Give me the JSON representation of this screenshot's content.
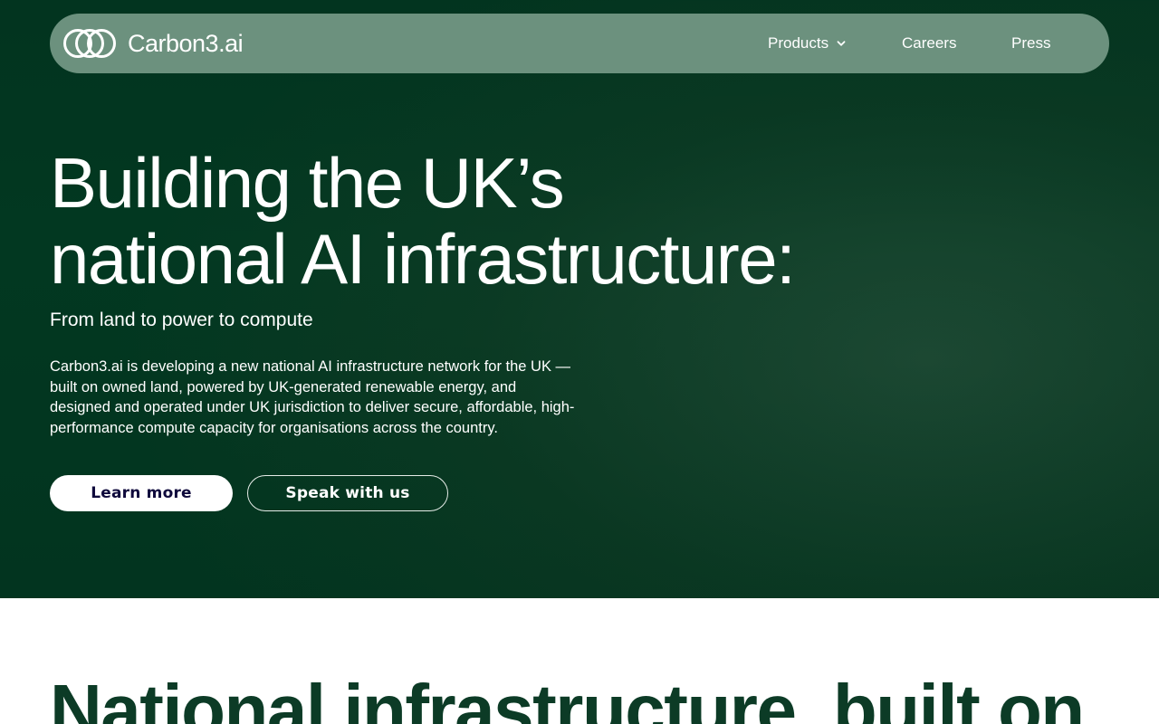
{
  "brand": {
    "name": "Carbon3.ai",
    "logo_icon": "interlocking-rings-logo"
  },
  "nav": {
    "items": [
      {
        "label": "Products",
        "icon": "chevron-down-icon"
      },
      {
        "label": "Careers"
      },
      {
        "label": "Press"
      }
    ]
  },
  "hero": {
    "headline_line1": "Building the UK’s",
    "headline_line2": "national AI infrastructure:",
    "subheading": "From land to power to compute",
    "body": "Carbon3.ai is developing a new national AI infrastructure network for the UK — built on owned land, powered by UK-generated renewable energy, and designed and operated under UK jurisdiction to deliver secure, affordable, high-performance compute capacity for organisations across the country.",
    "primary_cta": "Learn more",
    "secondary_cta": "Speak with us"
  },
  "section2": {
    "title": "National infrastructure, built on"
  },
  "colors": {
    "hero_bg": "#043822",
    "nav_bg": "#6c917e",
    "primary_button_text": "#0f0a3c",
    "section_title": "#0c3b26"
  }
}
